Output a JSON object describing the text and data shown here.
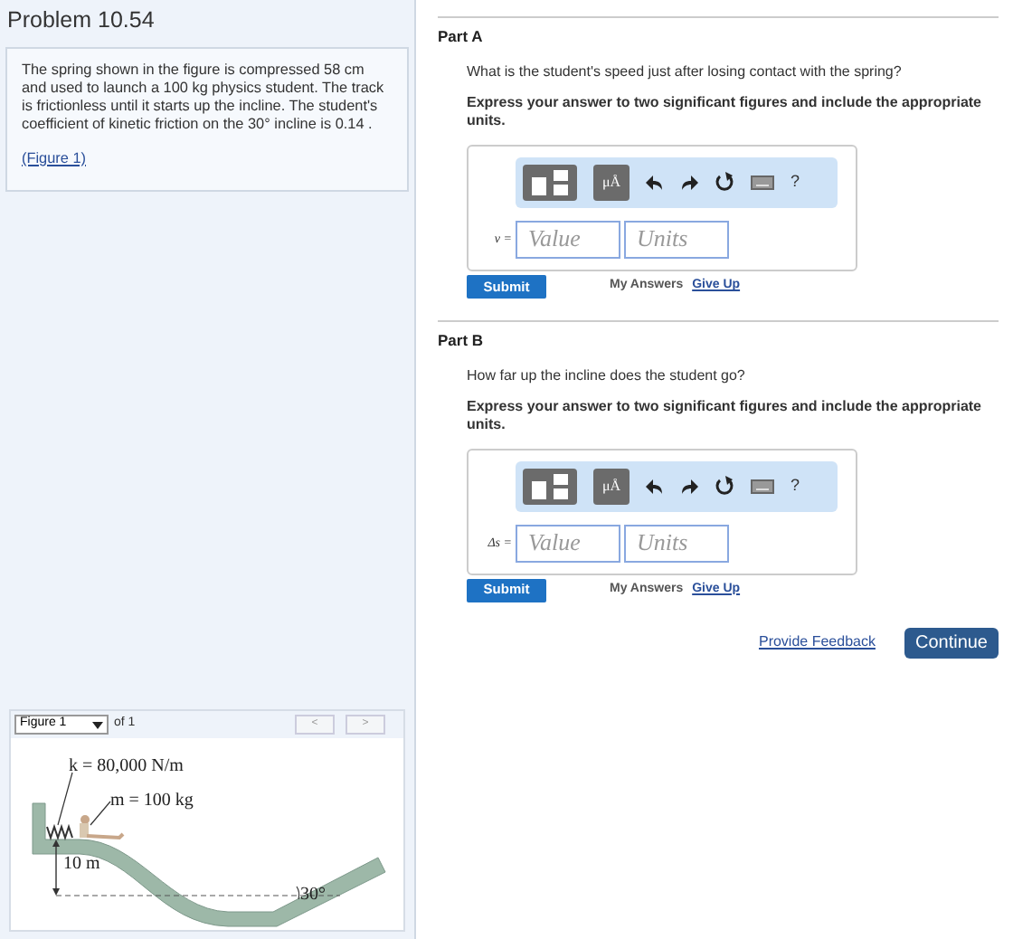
{
  "problem": {
    "title": "Problem 10.54",
    "text": "The spring shown in the figure is compressed 58 cm and used to launch a 100 kg physics student. The track is frictionless until it starts up the incline. The student's coefficient of kinetic friction on the 30° incline is 0.14 .",
    "figure_link": "(Figure 1)"
  },
  "figure_panel": {
    "selector": "Figure 1",
    "of": "of 1",
    "prev": "<",
    "next": ">",
    "labels": {
      "spring": "k = 80,000 N/m",
      "mass": "m = 100 kg",
      "height": "10 m",
      "angle": "30°"
    }
  },
  "parts": [
    {
      "title": "Part A",
      "question": "What is the student's speed just after losing contact with the spring?",
      "instruction": "Express your answer to two significant figures and include the appropriate units.",
      "variable": "v =",
      "value_placeholder": "Value",
      "units_placeholder": "Units",
      "unit_button": "μÅ",
      "help": "?",
      "submit": "Submit",
      "my_answers": "My Answers",
      "give_up": "Give Up"
    },
    {
      "title": "Part B",
      "question": "How far up the incline does the student go?",
      "instruction": "Express your answer to two significant figures and include the appropriate units.",
      "variable": "Δs =",
      "value_placeholder": "Value",
      "units_placeholder": "Units",
      "unit_button": "μÅ",
      "help": "?",
      "submit": "Submit",
      "my_answers": "My Answers",
      "give_up": "Give Up"
    }
  ],
  "footer": {
    "feedback": "Provide Feedback",
    "continue": "Continue"
  }
}
